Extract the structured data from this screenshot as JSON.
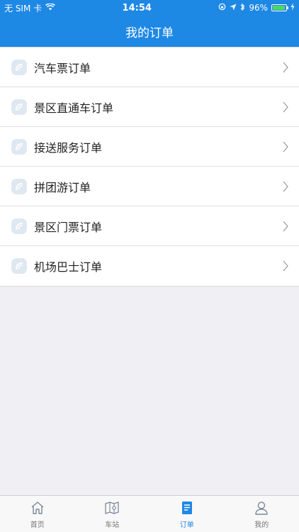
{
  "status_bar": {
    "carrier": "无 SIM 卡",
    "time": "14:54",
    "battery_percent": "96%",
    "battery_level": 0.96
  },
  "nav": {
    "title": "我的订单"
  },
  "orders": [
    {
      "label": "汽车票订单"
    },
    {
      "label": "景区直通车订单"
    },
    {
      "label": "接送服务订单"
    },
    {
      "label": "拼团游订单"
    },
    {
      "label": "景区门票订单"
    },
    {
      "label": "机场巴士订单"
    }
  ],
  "tabs": [
    {
      "label": "首页",
      "icon": "home-icon"
    },
    {
      "label": "车站",
      "icon": "map-icon"
    },
    {
      "label": "订单",
      "icon": "order-icon",
      "active": true
    },
    {
      "label": "我的",
      "icon": "user-icon"
    }
  ],
  "colors": {
    "primary": "#1e88e5",
    "background": "#efeff4",
    "battery": "#4cd964"
  }
}
